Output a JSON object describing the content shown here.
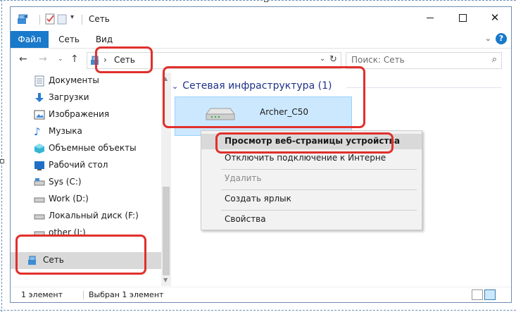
{
  "window": {
    "title": "Сеть"
  },
  "ribbon": {
    "tabs": [
      "Файл",
      "Сеть",
      "Вид"
    ]
  },
  "navigation": {
    "address_path": "Сеть",
    "search_placeholder": "Поиск: Сеть"
  },
  "sidebar": {
    "items": [
      {
        "label": "Документы",
        "icon": "documents-icon"
      },
      {
        "label": "Загрузки",
        "icon": "downloads-icon"
      },
      {
        "label": "Изображения",
        "icon": "pictures-icon"
      },
      {
        "label": "Музыка",
        "icon": "music-icon"
      },
      {
        "label": "Объемные объекты",
        "icon": "3d-objects-icon"
      },
      {
        "label": "Рабочий стол",
        "icon": "desktop-icon"
      },
      {
        "label": "Sys (C:)",
        "icon": "drive-icon"
      },
      {
        "label": "Work (D:)",
        "icon": "drive-icon"
      },
      {
        "label": "Локальный диск (F:)",
        "icon": "drive-icon"
      },
      {
        "label": "other (I:)",
        "icon": "drive-icon"
      },
      {
        "label": "Сеть",
        "icon": "network-icon",
        "selected": true
      }
    ]
  },
  "content": {
    "group_header": "Сетевая инфраструктура (1)",
    "device_name": "Archer_C50"
  },
  "context_menu": {
    "items": [
      {
        "label": "Просмотр веб-страницы устройства",
        "highlighted": true
      },
      {
        "label": "Отключить подключение к Интерне"
      },
      {
        "label": "Удалить",
        "disabled": true
      },
      {
        "label": "Создать ярлык"
      },
      {
        "label": "Свойства"
      }
    ]
  },
  "status_bar": {
    "count": "1 элемент",
    "selected": "Выбран 1 элемент"
  },
  "colors": {
    "accent": "#1979ca",
    "selection": "#cce8ff",
    "highlight_box": "#e0302c",
    "group_header": "#1e3287"
  }
}
